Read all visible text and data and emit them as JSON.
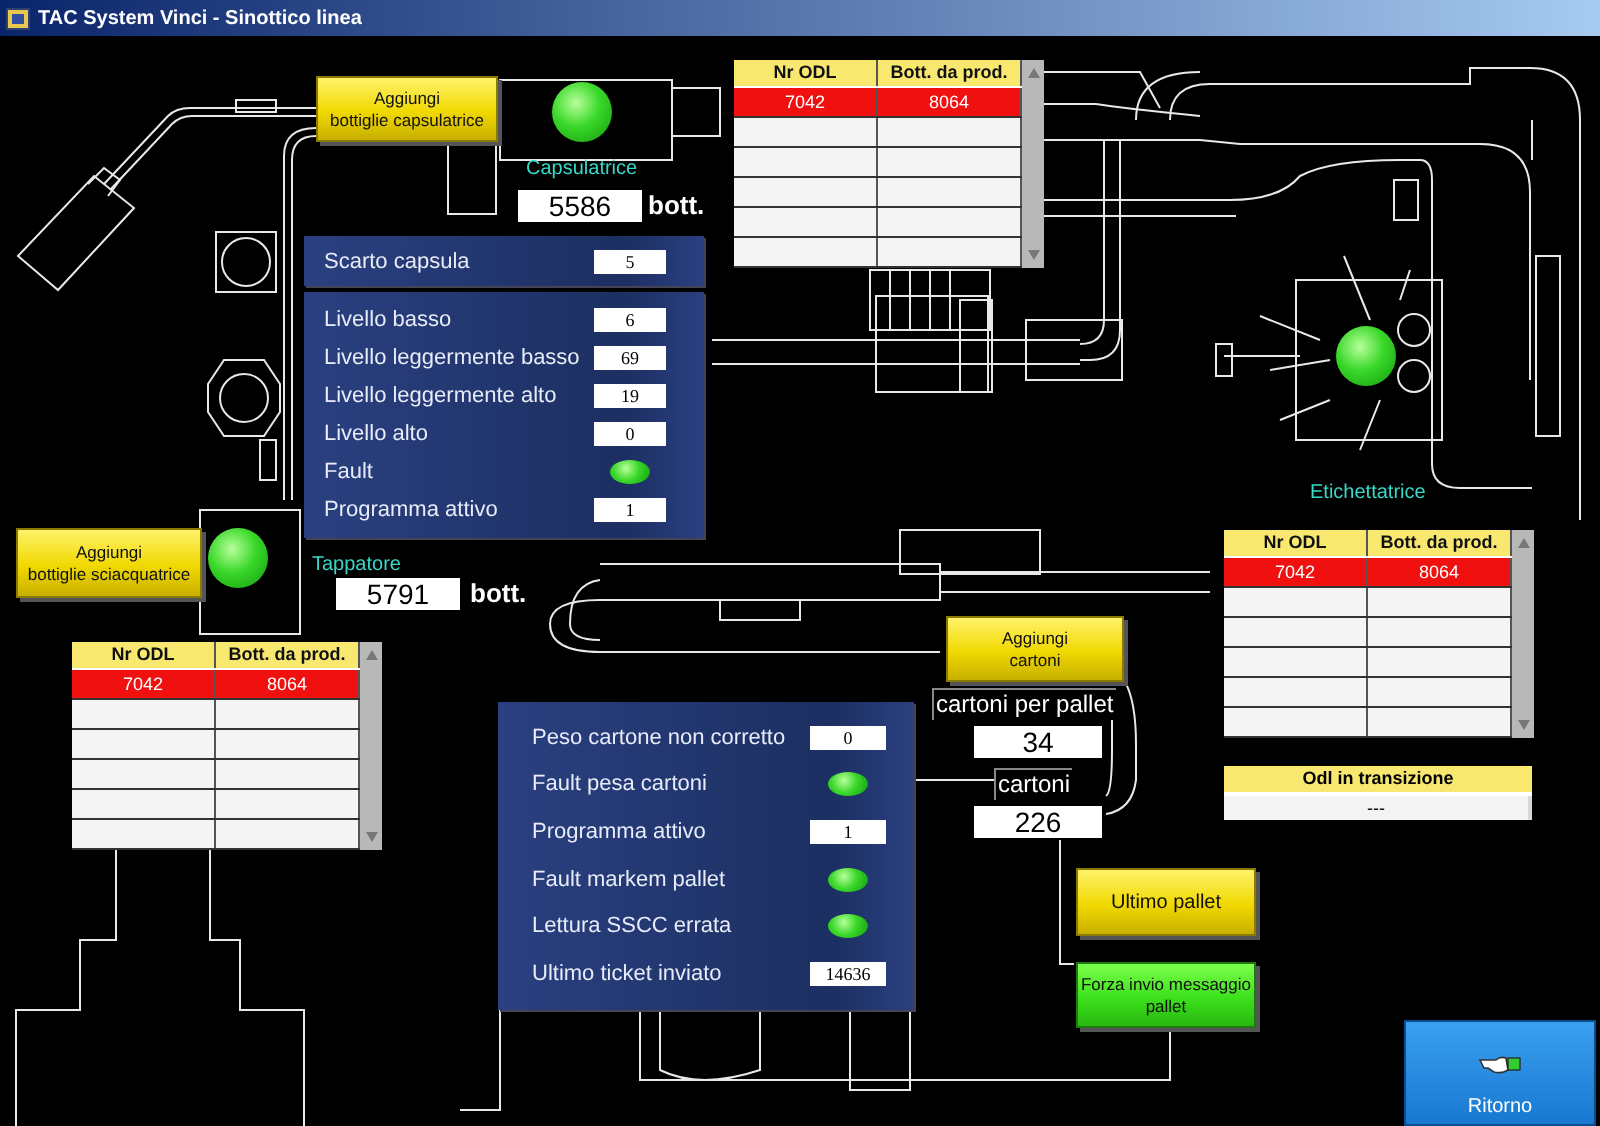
{
  "window": {
    "title": "TAC System Vinci - Sinottico linea"
  },
  "capsulatrice": {
    "button": "Aggiungi\nbottiglie capsulatrice",
    "running": true,
    "name": "Capsulatrice",
    "count": "5586",
    "unit": "bott."
  },
  "sciacquatrice": {
    "button": "Aggiungi\nbottiglie sciacquatrice",
    "running": true
  },
  "tappatore": {
    "name": "Tappatore",
    "count": "5791",
    "unit": "bott."
  },
  "etichettatrice": {
    "name": "Etichettatrice",
    "running": true
  },
  "odl_tables": [
    {
      "columns": [
        "Nr ODL",
        "Bott. da prod."
      ],
      "rows": [
        {
          "cells": [
            "7042",
            "8064"
          ],
          "selected": true
        }
      ]
    },
    {
      "columns": [
        "Nr ODL",
        "Bott. da prod."
      ],
      "rows": [
        {
          "cells": [
            "7042",
            "8064"
          ],
          "selected": true
        }
      ]
    },
    {
      "columns": [
        "Nr ODL",
        "Bott. da prod."
      ],
      "rows": [
        {
          "cells": [
            "7042",
            "8064"
          ],
          "selected": true
        }
      ]
    }
  ],
  "capsule_panel": {
    "rows": [
      {
        "kind": "value",
        "label": "Scarto capsula",
        "value": "5"
      }
    ]
  },
  "level_panel": {
    "rows": [
      {
        "kind": "value",
        "label": "Livello basso",
        "value": "6"
      },
      {
        "kind": "value",
        "label": "Livello leggermente basso",
        "value": "69"
      },
      {
        "kind": "value",
        "label": "Livello leggermente alto",
        "value": "19"
      },
      {
        "kind": "value",
        "label": "Livello alto",
        "value": "0"
      },
      {
        "kind": "lamp",
        "label": "Fault",
        "on": true
      },
      {
        "kind": "value",
        "label": "Programma attivo",
        "value": "1"
      }
    ]
  },
  "carton": {
    "button": "Aggiungi\ncartoni",
    "per_pallet_label": "cartoni per pallet",
    "per_pallet": "34",
    "count_label": "cartoni",
    "count": "226"
  },
  "transition": {
    "title": "Odl in transizione",
    "value": "---"
  },
  "pallet_panel": {
    "rows": [
      {
        "kind": "value",
        "label": "Peso cartone non corretto",
        "value": "0"
      },
      {
        "kind": "lamp",
        "label": "Fault pesa cartoni",
        "on": true
      },
      {
        "kind": "value",
        "label": "Programma attivo",
        "value": "1"
      },
      {
        "kind": "lamp",
        "label": "Fault markem pallet",
        "on": true
      },
      {
        "kind": "lamp",
        "label": "Lettura SSCC errata",
        "on": true
      },
      {
        "kind": "value",
        "label": "Ultimo ticket inviato",
        "value": "14636"
      }
    ]
  },
  "buttons": [
    {
      "kind": "yellow",
      "label": "Ultimo pallet"
    },
    {
      "kind": "green",
      "label": "Forza invio messaggio pallet"
    }
  ],
  "return_button": {
    "label": "Ritorno"
  }
}
